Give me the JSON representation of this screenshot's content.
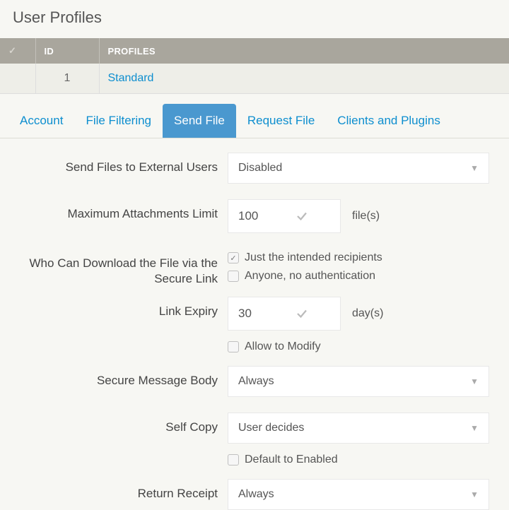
{
  "page_title": "User Profiles",
  "table": {
    "headers": {
      "id": "ID",
      "profiles": "PROFILES"
    },
    "rows": [
      {
        "id": "1",
        "name": "Standard"
      }
    ]
  },
  "tabs": [
    {
      "label": "Account"
    },
    {
      "label": "File Filtering"
    },
    {
      "label": "Send File",
      "active": true
    },
    {
      "label": "Request File"
    },
    {
      "label": "Clients and Plugins"
    }
  ],
  "form": {
    "send_external": {
      "label": "Send Files to External Users",
      "value": "Disabled"
    },
    "max_attach": {
      "label": "Maximum Attachments Limit",
      "value": "100",
      "unit": "file(s)"
    },
    "who_download": {
      "label": "Who Can Download the File via the Secure Link",
      "opt1": "Just the intended recipients",
      "opt2": "Anyone, no authentication"
    },
    "link_expiry": {
      "label": "Link Expiry",
      "value": "30",
      "unit": "day(s)"
    },
    "allow_modify": {
      "label": "Allow to Modify"
    },
    "secure_body": {
      "label": "Secure Message Body",
      "value": "Always"
    },
    "self_copy": {
      "label": "Self Copy",
      "value": "User decides"
    },
    "default_enabled": {
      "label": "Default to Enabled"
    },
    "return_receipt": {
      "label": "Return Receipt",
      "value": "Always"
    }
  }
}
